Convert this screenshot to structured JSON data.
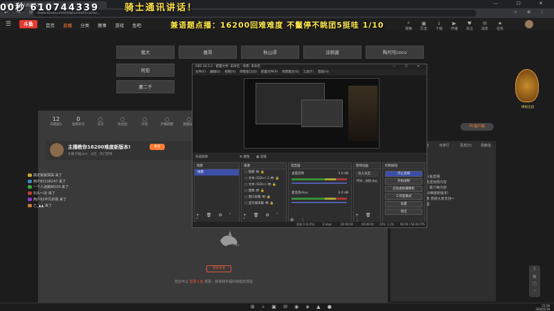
{
  "browser": {
    "tab_title": "斗鱼 - 每个人的直播平台",
    "url": "www.douyu.com/topic/ceshi/cycle/... ",
    "window_buttons": "— ☐ ✕",
    "nav_glyphs": "← → ⟳ ⌂",
    "right_glyphs": "☆ ⊕ ⋮"
  },
  "overlays": {
    "top_left": "00秒 610744339",
    "top_right": "骑士通讯讲话！",
    "marquee": "兼语题点播：16200回难难度 不鬣停不眺团5挺哇 1/10"
  },
  "site_nav": {
    "logo": "斗鱼",
    "links": [
      "首页",
      "直播",
      "分类",
      "赛事",
      "游戏",
      "鱼吧"
    ],
    "active_index": 1,
    "right_items": [
      {
        "icon": "⌕",
        "label": "搜索"
      },
      {
        "icon": "▣",
        "label": "历史"
      },
      {
        "icon": "↓",
        "label": "下载"
      },
      {
        "icon": "▶",
        "label": "开播"
      },
      {
        "icon": "♥",
        "label": "关注"
      },
      {
        "icon": "✉",
        "label": "消息"
      },
      {
        "icon": "★",
        "label": "任务"
      }
    ]
  },
  "streamer_grid": [
    "猪大",
    "骚哥",
    "秋山澪",
    "涂鸦酱",
    "陶可可coco",
    "阿愈",
    "董二千"
  ],
  "stats": [
    {
      "value": "12",
      "label": "去赠送礼"
    },
    {
      "value": "0",
      "label": "鱼粮背包"
    },
    {
      "value": "",
      "label": "日活"
    },
    {
      "value": "",
      "label": "粉丝团"
    },
    {
      "value": "",
      "label": "声音"
    },
    {
      "value": "",
      "label": "开播提醒"
    },
    {
      "value": "",
      "label": "直播设置"
    }
  ],
  "pc_button": "PC客户端",
  "room": {
    "title": "主播教你16200难度新版本!",
    "follow": "关注",
    "sub": "主播 阿猫zzm  ·  分区 · 热门游戏"
  },
  "chat_log": [
    {
      "color": "#c8a83a",
      "text": "搞定紫紫探探 来了"
    },
    {
      "color": "#3a8ac8",
      "text": "用户82136247 来了"
    },
    {
      "color": "#3aa83a",
      "text": "一个人迷路到100 来了"
    },
    {
      "color": "#c83a3a",
      "text": "石头～凉 来了"
    },
    {
      "color": "#8a3ac8",
      "text": "用户92平凡的我 来了"
    },
    {
      "color": "#c87a3a",
      "text": "乙_▲▲ 来了"
    }
  ],
  "login": {
    "button": "登录发送",
    "prefix": "您还可以 ",
    "highlight": "登录斗鱼",
    "suffix": " 观看，获得钱币福利和稳定体验"
  },
  "right_chat": {
    "tabs": [
      "排行榜",
      "贡献榜",
      "日排行",
      "贵宾(0)",
      "贡献值"
    ],
    "lines": [
      "还不睡",
      "主播你好，欢迎来到斗鱼直播",
      "本直播间弹幕不可以发送违规内容",
      "禁止发布低俗、色情、暴力等内容",
      "主播：主播教你16200难度新版本!",
      "公告：记得刷新完光降 感谢大家支持～",
      "我是凡夫俗子：还不睡"
    ]
  },
  "game_badge": "佩妮庄园",
  "obs": {
    "title": "OBS 30.1.2 - 配置文件: 未命名 - 场景: 未命名",
    "menu": [
      "文件(F)",
      "编辑(E)",
      "视图(V)",
      "停靠窗口(D)",
      "配置文件(P)",
      "场景集合(S)",
      "工具(T)",
      "帮助(H)"
    ],
    "source_bar": [
      "未选择源",
      "属性",
      "滤镜"
    ],
    "scenes_title": "场景",
    "scenes": [
      "场景"
    ],
    "sources_title": "来源",
    "sources": [
      "图像",
      "文本 (GDI+) 2",
      "文本 (GDI+)",
      "图像",
      "窗口采集",
      "显示器采集"
    ],
    "mixer_title": "混音器",
    "mixer": [
      {
        "name": "桌面音频",
        "db": "0.0 dB"
      },
      {
        "name": "麦克风/Aux",
        "db": "0.0 dB"
      }
    ],
    "transitions_title": "转场动画",
    "transition": "淡入淡出",
    "duration_label": "时长",
    "duration": "300 ms",
    "controls_title": "控制按钮",
    "controls": [
      "停止直播",
      "开始录制",
      "启动虚拟摄像机",
      "工作室模式",
      "设置",
      "退出"
    ],
    "status": {
      "dropped": "丢帧 0 (0.0%)",
      "bitrate": "0 kbps",
      "live_time": "00:00:00",
      "rec_time": "00:00:00",
      "cpu": "CPU: 1.1%",
      "fps": "60.00 / 60.00 FPS"
    }
  },
  "taskbar": {
    "icons": "⊞ ⌕ ▣ ✉ ◉ ◈ ▲ ●",
    "time": "21:56",
    "date": "2024/5/18"
  }
}
